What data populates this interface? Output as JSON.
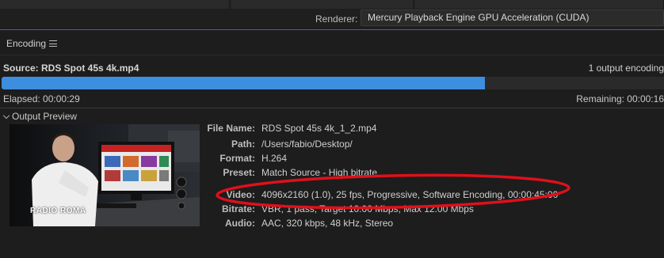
{
  "renderer": {
    "label": "Renderer:",
    "value": "Mercury Playback Engine GPU Acceleration (CUDA)"
  },
  "panel": {
    "tab_label": "Encoding",
    "menu_icon": "hamburger-icon"
  },
  "encoding": {
    "source_label": "Source: RDS Spot 45s 4k.mp4",
    "output_count": "1 output encoding",
    "progress": 0.73,
    "elapsed": "Elapsed: 00:00:29",
    "remaining": "Remaining: 00:00:16"
  },
  "output_preview": {
    "title": "Output Preview",
    "thumbnail_logo": "RADIO ROMA",
    "details": [
      {
        "key": "File Name:",
        "value": "RDS Spot 45s 4k_1_2.mp4"
      },
      {
        "key": "Path:",
        "value": "/Users/fabio/Desktop/"
      },
      {
        "key": "Format:",
        "value": "H.264"
      },
      {
        "key": "Preset:",
        "value": "Match Source - High bitrate"
      },
      {
        "key": "Video:",
        "value": "4096x2160 (1.0), 25 fps, Progressive, Software Encoding, 00:00:45:00"
      },
      {
        "key": "Bitrate:",
        "value": "VBR, 1 pass, Target 10.00 Mbps, Max 12.00 Mbps"
      },
      {
        "key": "Audio:",
        "value": "AAC, 320 kbps, 48 kHz, Stereo"
      }
    ]
  },
  "colors": {
    "accent": "#3e8ee0",
    "annotation": "#e0101b"
  }
}
